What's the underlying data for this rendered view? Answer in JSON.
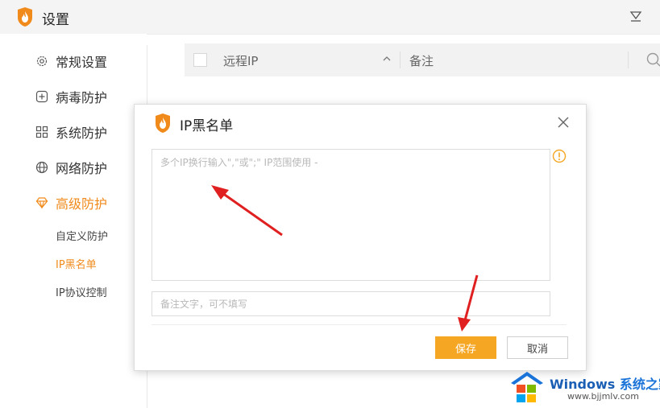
{
  "window": {
    "title": "设置"
  },
  "sidebar": {
    "items": [
      {
        "label": "常规设置",
        "icon": "gear-icon"
      },
      {
        "label": "病毒防护",
        "icon": "plus-square-icon"
      },
      {
        "label": "系统防护",
        "icon": "grid-icon"
      },
      {
        "label": "网络防护",
        "icon": "globe-icon"
      },
      {
        "label": "高级防护",
        "icon": "diamond-icon"
      }
    ],
    "subitems": [
      {
        "label": "自定义防护"
      },
      {
        "label": "IP黑名单"
      },
      {
        "label": "IP协议控制"
      }
    ],
    "active_item": "高级防护",
    "active_subitem": "IP黑名单"
  },
  "table": {
    "columns": [
      "远程IP",
      "备注"
    ]
  },
  "dialog": {
    "title": "IP黑名单",
    "ip_placeholder": "多个IP换行输入\",\"或\";\" IP范围使用 -",
    "note_placeholder": "备注文字，可不填写",
    "save_label": "保存",
    "cancel_label": "取消"
  },
  "colors": {
    "accent": "#f08a1b",
    "save_button": "#f5a623",
    "arrow": "#e02020"
  },
  "watermark": {
    "brand_en": "Windows",
    "brand_cn": "系统之家",
    "url": "www.bjjmlv.com"
  }
}
